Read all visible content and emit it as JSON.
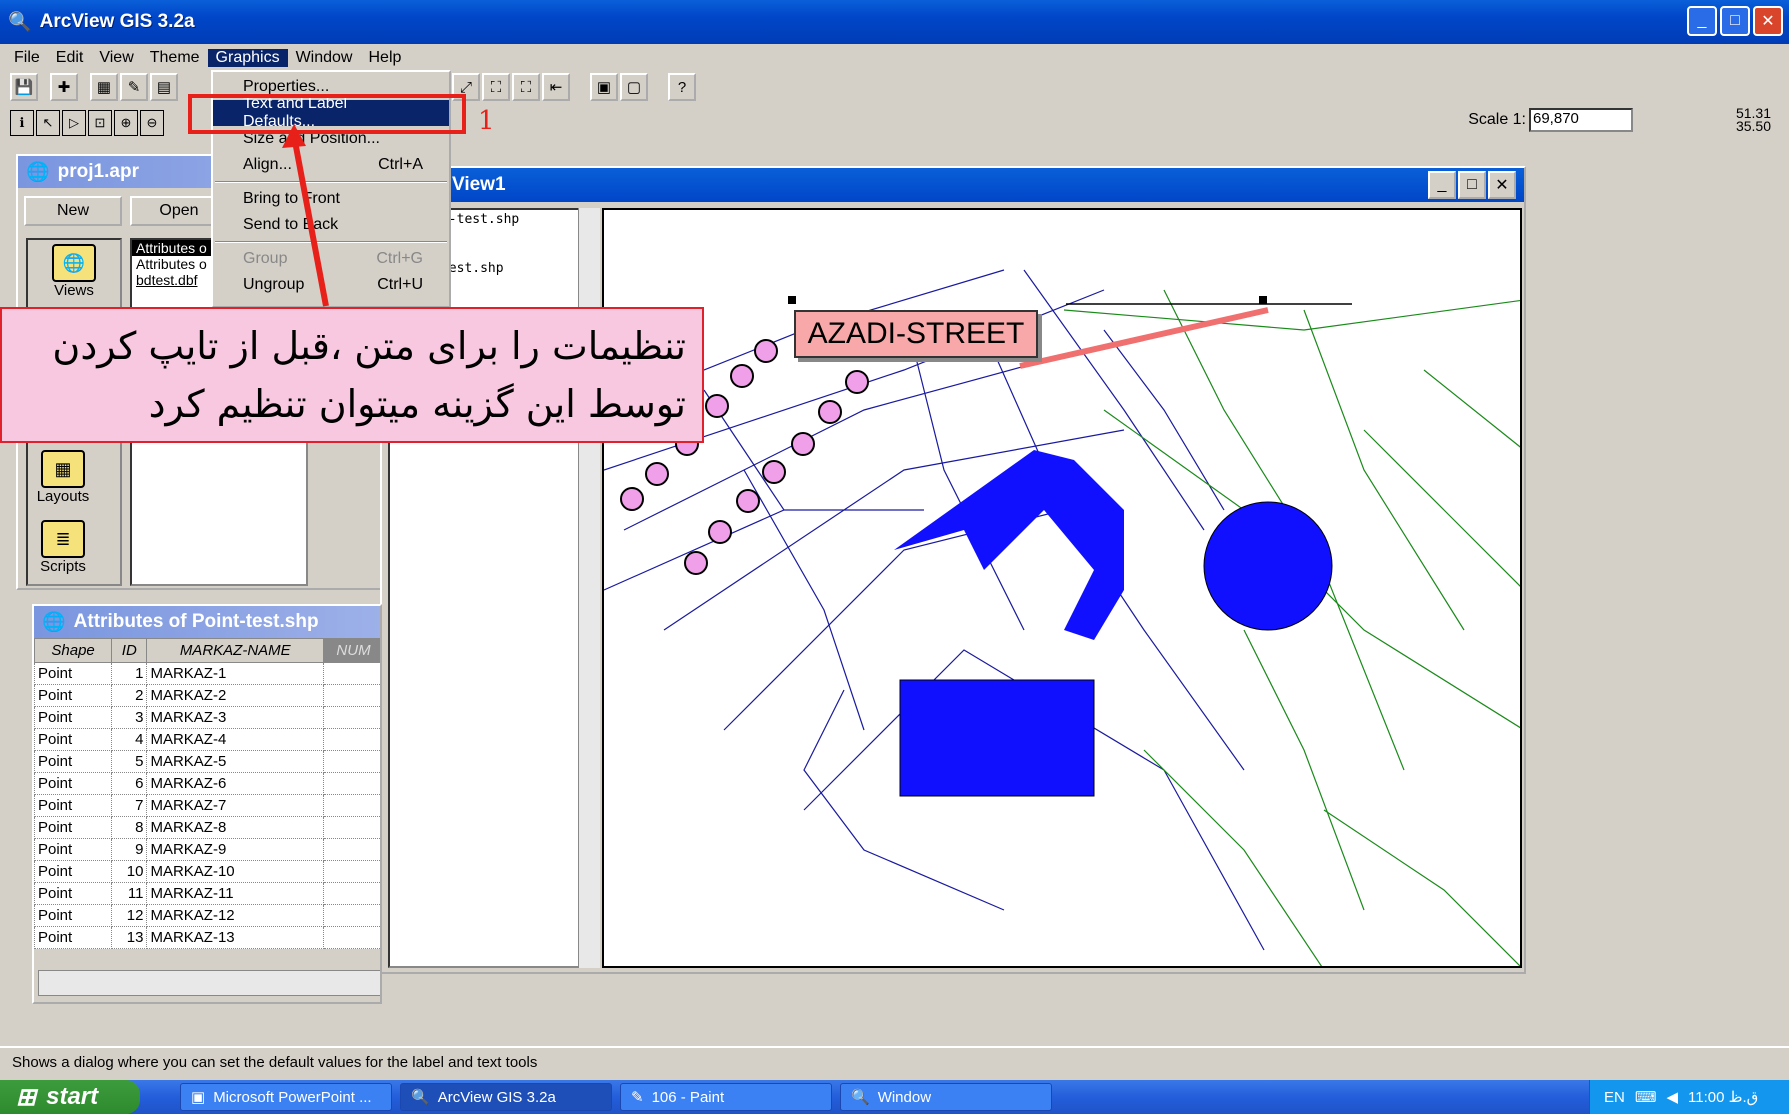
{
  "window": {
    "title": "ArcView GIS 3.2a"
  },
  "menubar": [
    "File",
    "Edit",
    "View",
    "Theme",
    "Graphics",
    "Window",
    "Help"
  ],
  "toolbar": {
    "scale_label": "Scale 1:",
    "scale_value": "69,870",
    "coord_x": "51.31",
    "coord_y": "35.50"
  },
  "project": {
    "title": "proj1.apr",
    "new": "New",
    "open": "Open",
    "items": [
      "Attributes o",
      "Attributes o",
      "bdtest.dbf"
    ],
    "icons": [
      "Views",
      "Layouts",
      "Scripts"
    ]
  },
  "view": {
    "title": "View1",
    "themes": [
      "Poligon-test.shp",
      "Point-test.shp"
    ],
    "label": "AZADI-STREET"
  },
  "graphics_menu": {
    "items": [
      {
        "label": "Properties...",
        "shortcut": "",
        "disabled": false
      },
      {
        "label": "Text and Label Defaults...",
        "shortcut": "",
        "disabled": false,
        "selected": true
      },
      {
        "label": "Size and Position...",
        "shortcut": "",
        "disabled": false
      },
      {
        "label": "Align...",
        "shortcut": "Ctrl+A",
        "disabled": false
      },
      {
        "label": "Bring to Front",
        "shortcut": "",
        "disabled": false
      },
      {
        "label": "Send to Back",
        "shortcut": "",
        "disabled": false
      },
      {
        "label": "Group",
        "shortcut": "Ctrl+G",
        "disabled": true
      },
      {
        "label": "Ungroup",
        "shortcut": "Ctrl+U",
        "disabled": false
      }
    ]
  },
  "annotation": {
    "number": "1",
    "callout_line1": "تنظیمات را برای متن ،قبل از تایپ کردن",
    "callout_line2": "توسط این گزینه میتوان تنظیم کرد"
  },
  "attributes": {
    "title": "Attributes of Point-test.shp",
    "headers": [
      "Shape",
      "ID",
      "MARKAZ-NAME",
      "NUM"
    ],
    "rows": [
      [
        "Point",
        "1",
        "MARKAZ-1"
      ],
      [
        "Point",
        "2",
        "MARKAZ-2"
      ],
      [
        "Point",
        "3",
        "MARKAZ-3"
      ],
      [
        "Point",
        "4",
        "MARKAZ-4"
      ],
      [
        "Point",
        "5",
        "MARKAZ-5"
      ],
      [
        "Point",
        "6",
        "MARKAZ-6"
      ],
      [
        "Point",
        "7",
        "MARKAZ-7"
      ],
      [
        "Point",
        "8",
        "MARKAZ-8"
      ],
      [
        "Point",
        "9",
        "MARKAZ-9"
      ],
      [
        "Point",
        "10",
        "MARKAZ-10"
      ],
      [
        "Point",
        "11",
        "MARKAZ-11"
      ],
      [
        "Point",
        "12",
        "MARKAZ-12"
      ],
      [
        "Point",
        "13",
        "MARKAZ-13"
      ]
    ]
  },
  "status": "Shows a dialog where you can set the default values for the label and text tools",
  "taskbar": {
    "start": "start",
    "tasks": [
      "Microsoft PowerPoint ...",
      "ArcView GIS 3.2a",
      "106 - Paint",
      "Window"
    ],
    "lang": "EN",
    "clock": "11:00 ق.ظ"
  }
}
